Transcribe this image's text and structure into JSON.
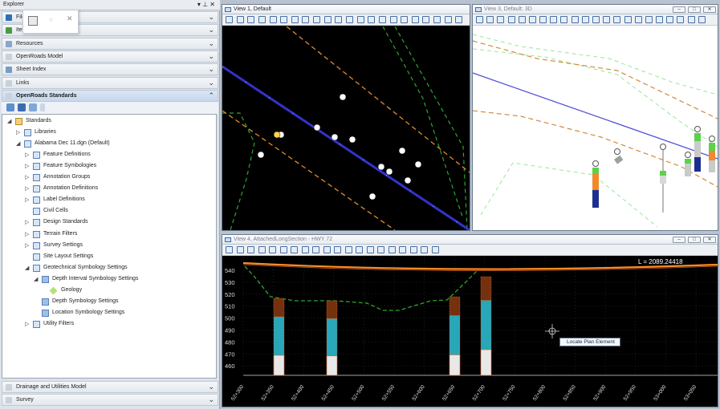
{
  "explorer": {
    "title": "Explorer",
    "ctrl_pin": "▾ ⊥ ✕",
    "top_sections": [
      {
        "label": "File",
        "icon_color": "#2f6fb4"
      },
      {
        "label": "Item",
        "icon_color": "#4c9a3e"
      },
      {
        "label": "Resources",
        "icon_color": "#8aa7c8"
      },
      {
        "label": "OpenRoads Model",
        "icon_color": "#c9d1db"
      },
      {
        "label": "Sheet Index",
        "icon_color": "#7a9bc2"
      },
      {
        "label": "Links",
        "icon_color": "#c9d1db"
      },
      {
        "label": "OpenRoads Standards",
        "icon_color": "#c9d1db"
      }
    ],
    "bottom_sections": [
      {
        "label": "Drainage and Utilities Model",
        "icon_color": "#c9d1db"
      },
      {
        "label": "Survey",
        "icon_color": "#c9d1db"
      }
    ],
    "tree": [
      {
        "label": "Standards",
        "level": 0,
        "toggle": "◢",
        "icon": "folder"
      },
      {
        "label": "Libraries",
        "level": 1,
        "toggle": "▷",
        "icon": "lib"
      },
      {
        "label": "Alabama Dec 11.dgn (Default)",
        "level": 1,
        "toggle": "◢",
        "icon": "lib"
      },
      {
        "label": "Feature Definitions",
        "level": 2,
        "toggle": "▷",
        "icon": "lib"
      },
      {
        "label": "Feature Symbologies",
        "level": 2,
        "toggle": "▷",
        "icon": "lib"
      },
      {
        "label": "Annotation Groups",
        "level": 2,
        "toggle": "▷",
        "icon": "lib"
      },
      {
        "label": "Annotation Definitions",
        "level": 2,
        "toggle": "▷",
        "icon": "lib"
      },
      {
        "label": "Label Definitions",
        "level": 2,
        "toggle": "▷",
        "icon": "lib"
      },
      {
        "label": "Civil Cells",
        "level": 2,
        "toggle": "",
        "icon": "lib"
      },
      {
        "label": "Design Standards",
        "level": 2,
        "toggle": "▷",
        "icon": "lib"
      },
      {
        "label": "Terrain Filters",
        "level": 2,
        "toggle": "▷",
        "icon": "lib"
      },
      {
        "label": "Survey Settings",
        "level": 2,
        "toggle": "▷",
        "icon": "lib"
      },
      {
        "label": "Site Layout Settings",
        "level": 2,
        "toggle": "",
        "icon": "lib"
      },
      {
        "label": "Geotechnical Symbology Settings",
        "level": 2,
        "toggle": "◢",
        "icon": "lib"
      },
      {
        "label": "Depth Interval Symbology Settings",
        "level": 3,
        "toggle": "◢",
        "icon": "geo"
      },
      {
        "label": "Geology",
        "level": 4,
        "toggle": "",
        "icon": "gem"
      },
      {
        "label": "Depth Symbology Settings",
        "level": 3,
        "toggle": "",
        "icon": "geo"
      },
      {
        "label": "Location Symbology Settings",
        "level": 3,
        "toggle": "",
        "icon": "geo"
      },
      {
        "label": "Utility Filters",
        "level": 2,
        "toggle": "▷",
        "icon": "lib"
      }
    ]
  },
  "views": {
    "v1": {
      "title": "View 1, Default"
    },
    "v3": {
      "title": "View 3, Default: 3D"
    },
    "v4": {
      "title": "View 4, AttachedLongSection - HWY 72"
    }
  },
  "profile": {
    "length_label": "L = 2089.24418",
    "elevations": [
      "540",
      "530",
      "520",
      "510",
      "500",
      "490",
      "480",
      "470",
      "460"
    ],
    "stations": [
      "52+300",
      "52+350",
      "52+400",
      "52+450",
      "52+500",
      "52+550",
      "52+600",
      "52+650",
      "52+700",
      "52+750",
      "52+800",
      "52+850",
      "52+900",
      "52+950",
      "53+000",
      "53+050"
    ]
  },
  "tooltip": "Locate Plan Element",
  "colors": {
    "background": "#000000",
    "alignment": "#3333cc",
    "edge": "#e38a2b",
    "ground": "#2fa52f",
    "accent": "#ff8c2a"
  }
}
